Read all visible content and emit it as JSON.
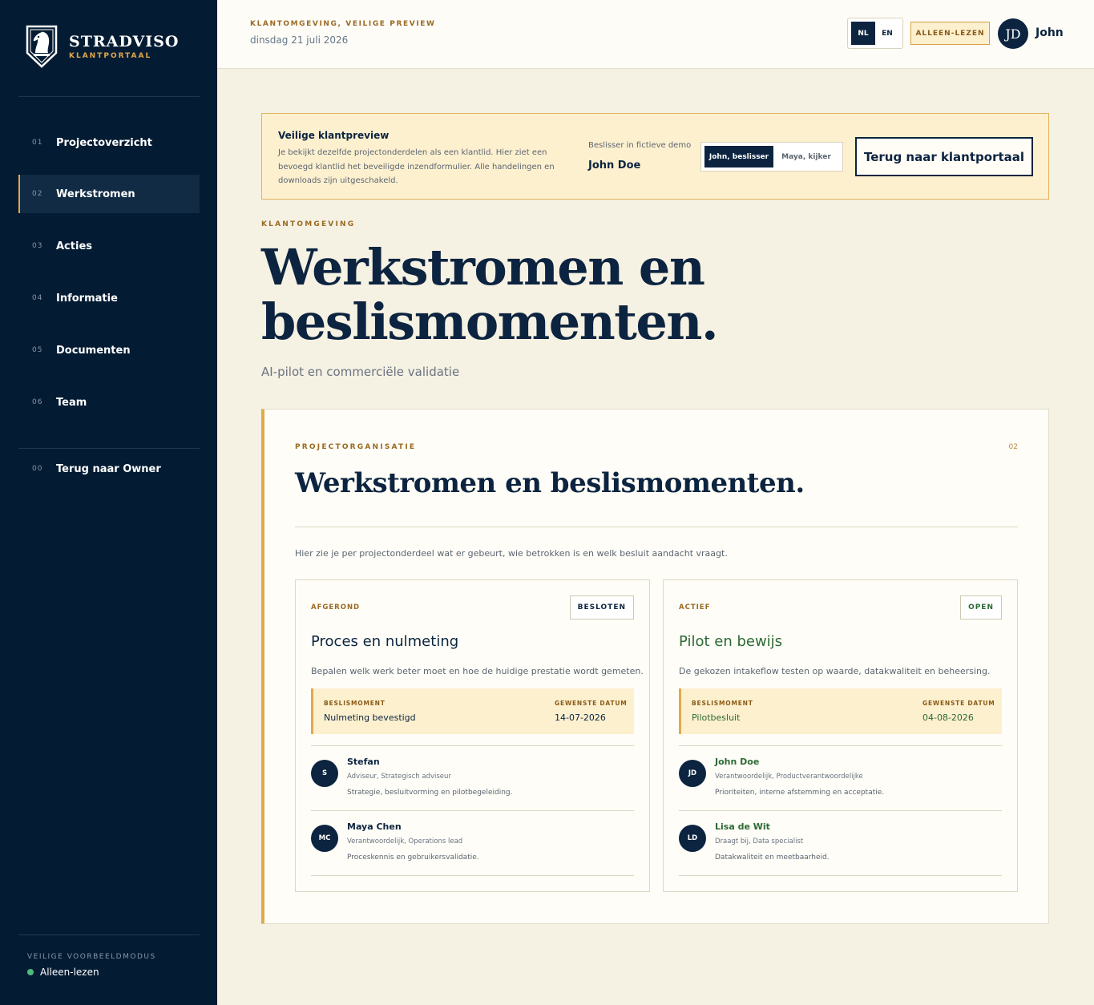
{
  "brand": {
    "name": "STRADVISO",
    "subtitle": "KLANTPORTAAL"
  },
  "sidebar": {
    "items": [
      {
        "num": "01",
        "label": "Projectoverzicht",
        "active": false
      },
      {
        "num": "02",
        "label": "Werkstromen",
        "active": true
      },
      {
        "num": "03",
        "label": "Acties",
        "active": false
      },
      {
        "num": "04",
        "label": "Informatie",
        "active": false
      },
      {
        "num": "05",
        "label": "Documenten",
        "active": false
      },
      {
        "num": "06",
        "label": "Team",
        "active": false
      }
    ],
    "back": {
      "num": "00",
      "label": "Terug naar Owner"
    },
    "footer_label": "VEILIGE VOORBEELDMODUS",
    "footer_status": "Alleen-lezen"
  },
  "topbar": {
    "kicker": "KLANTOMGEVING, VEILIGE PREVIEW",
    "date": "dinsdag 21 juli 2026",
    "lang_nl": "NL",
    "lang_en": "EN",
    "readonly": "ALLEEN-LEZEN",
    "avatar": "JD",
    "user": "John"
  },
  "banner": {
    "title": "Veilige klantpreview",
    "text": "Je bekijkt dezelfde projectonderdelen als een klantlid. Hier ziet een bevoegd klantlid het beveiligde inzendformulier. Alle handelingen en downloads zijn uitgeschakeld.",
    "decider_label": "Beslisser in fictieve demo",
    "decider_name": "John Doe",
    "role_active": "John, beslisser",
    "role_other": "Maya, kijker",
    "back_button": "Terug naar klantportaal"
  },
  "hero": {
    "kicker": "KLANTOMGEVING",
    "title": "Werkstromen en beslismomenten.",
    "subtitle": "AI-pilot en commerciële validatie"
  },
  "card": {
    "kicker": "PROJECTORGANISATIE",
    "number": "02",
    "title": "Werkstromen en beslismomenten.",
    "intro": "Hier zie je per projectonderdeel wat er gebeurt, wie betrokken is en welk besluit aandacht vraagt.",
    "streams": [
      {
        "status": "AFGEROND",
        "badge": "BESLOTEN",
        "title": "Proces en nulmeting",
        "description": "Bepalen welk werk beter moet en hoe de huidige prestatie wordt gemeten.",
        "decision_label": "BESLISMOMENT",
        "decision": "Nulmeting bevestigd",
        "date_label": "GEWENSTE DATUM",
        "date": "14-07-2026",
        "members": [
          {
            "initials": "S",
            "name": "Stefan",
            "role": "Adviseur, Strategisch adviseur",
            "note": "Strategie, besluitvorming en pilotbegeleiding."
          },
          {
            "initials": "MC",
            "name": "Maya Chen",
            "role": "Verantwoordelijk, Operations lead",
            "note": "Proceskennis en gebruikersvalidatie."
          }
        ]
      },
      {
        "status": "ACTIEF",
        "badge": "OPEN",
        "title": "Pilot en bewijs",
        "description": "De gekozen intakeflow testen op waarde, datakwaliteit en beheersing.",
        "decision_label": "BESLISMOMENT",
        "decision": "Pilotbesluit",
        "date_label": "GEWENSTE DATUM",
        "date": "04-08-2026",
        "members": [
          {
            "initials": "JD",
            "name": "John Doe",
            "role": "Verantwoordelijk, Productverantwoordelijke",
            "note": "Prioriteiten, interne afstemming en acceptatie."
          },
          {
            "initials": "LD",
            "name": "Lisa de Wit",
            "role": "Draagt bij, Data specialist",
            "note": "Datakwaliteit en meetbaarheid."
          }
        ]
      }
    ]
  },
  "colors": {
    "navy": "#041c33",
    "gold": "#e3a64b",
    "green": "#2d6a34",
    "cream": "#f5f1e3"
  }
}
